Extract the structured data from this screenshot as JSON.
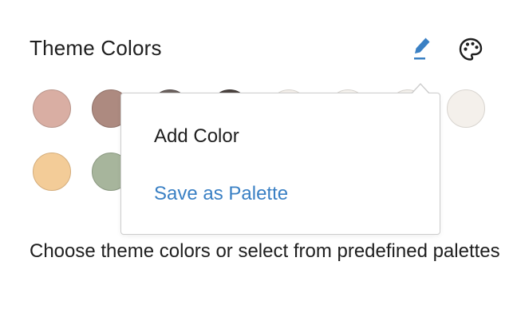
{
  "section": {
    "title": "Theme Colors",
    "help_text": "Choose theme colors or select from predefined palettes"
  },
  "toolbar": {
    "edit_icon": "pencil-icon",
    "palette_icon": "palette-icon",
    "accent_color": "#3a80c4"
  },
  "swatches": [
    {
      "color": "#d9aea3",
      "border": "#b8948a"
    },
    {
      "color": "#ad8a80",
      "border": "#8f7067"
    },
    {
      "color": "#6d6360",
      "border": "#554c4a"
    },
    {
      "color": "#4c4440",
      "border": "#3a3330"
    },
    {
      "color": "#f3efea",
      "border": "#d6d2cd"
    },
    {
      "color": "#f5f2ee",
      "border": "#d6d2cd"
    },
    {
      "color": "#f3f0ec",
      "border": "#d6d2cd"
    },
    {
      "color": "#f4f0eb",
      "border": "#d8d4cf"
    },
    {
      "color": "#f3cc98",
      "border": "#d4ad7c"
    },
    {
      "color": "#a7b59c",
      "border": "#8a9880"
    }
  ],
  "popover": {
    "items": [
      {
        "label": "Add Color"
      },
      {
        "label": "Save as Palette",
        "color": "#3a80c4"
      }
    ]
  }
}
